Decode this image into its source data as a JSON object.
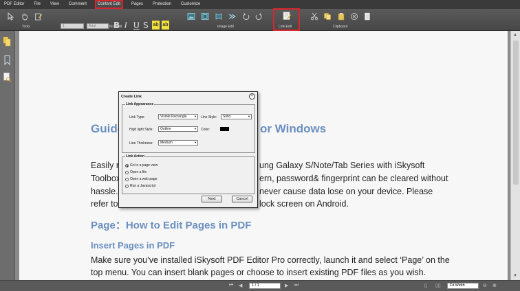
{
  "menubar": {
    "items": [
      "PDF Editor",
      "File",
      "View",
      "Comment",
      "Content Edit",
      "Pages",
      "Protection",
      "Customize"
    ],
    "active": "Content Edit"
  },
  "ribbon": {
    "groups": [
      "Tools",
      "Text Edit",
      "Image Edit",
      "Link Edit",
      "Clipboard"
    ],
    "font_size_value": "1",
    "font_name_value": "Arial",
    "format_buttons": [
      "B",
      "I",
      "U",
      "S"
    ],
    "highlight_labels": [
      "ab",
      "ab"
    ]
  },
  "document": {
    "heading1_left": "Guide",
    "heading1_right": "or Windows",
    "para1_line1_left": "Easily re",
    "para1_line1_right": "ung Galaxy S/Note/Tab Series with iSkysoft",
    "para1_line2_left": "Toolbox",
    "para1_line2_right": "ern, password& fingerprint can be cleared without",
    "para1_line3_left": "hassle. M",
    "para1_line3_right": "never cause data lose on your device. Please",
    "para1_line4_left": "refer to",
    "para1_line4_right": "lock screen on Android.",
    "heading2": "Page：How to Edit Pages in PDF",
    "heading3": "Insert Pages in PDF",
    "para2_line1": "Make sure you’ve installed iSkysoft PDF Editor Pro correctly, launch it and select ‘Page’ on the",
    "para2_line2": "top menu. You can insert blank pages or choose to insert existing PDF files as you wish."
  },
  "dialog": {
    "title": "Create Link",
    "appearance_legend": "Link Appearance",
    "link_type_label": "Link Type:",
    "link_type_value": "Visible Rectangle",
    "line_style_label": "Line Style:",
    "line_style_value": "Solid",
    "highlight_style_label": "High light Style:",
    "highlight_style_value": "Outline",
    "color_label": "Color:",
    "color_value": "#000000",
    "line_thickness_label": "Line Thickness:",
    "line_thickness_value": "Medium",
    "action_legend": "Link Action",
    "actions": [
      {
        "label": "Go to a page view",
        "selected": true
      },
      {
        "label": "Open a file",
        "selected": false
      },
      {
        "label": "Open a web page",
        "selected": false
      },
      {
        "label": "Run a Javascript",
        "selected": false
      }
    ],
    "next_label": "Next",
    "cancel_label": "Cancel"
  },
  "statusbar": {
    "page_value": "1 / 1",
    "zoom_value": "Fit Width"
  },
  "colors": {
    "accent_red": "#d9262c",
    "heading_blue": "#6b8fc0"
  }
}
